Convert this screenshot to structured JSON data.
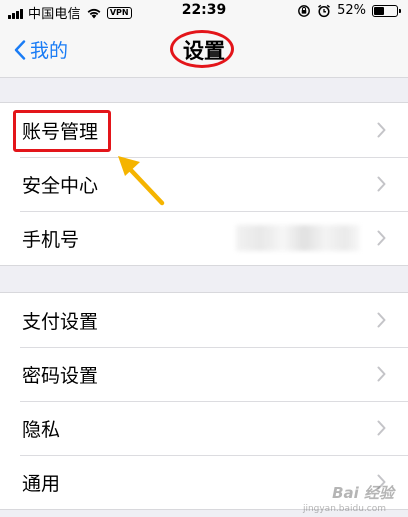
{
  "status_bar": {
    "carrier": "中国电信",
    "vpn": "VPN",
    "time": "22:39",
    "battery_percent": "52%",
    "battery_level": 0.52,
    "icons": [
      "signal-icon",
      "wifi-icon",
      "rotation-lock-icon",
      "alarm-icon",
      "battery-icon"
    ]
  },
  "nav": {
    "back_label": "我的",
    "title": "设置"
  },
  "groups": [
    {
      "items": [
        {
          "label": "账号管理"
        },
        {
          "label": "安全中心"
        },
        {
          "label": "手机号"
        }
      ]
    },
    {
      "items": [
        {
          "label": "支付设置"
        },
        {
          "label": "密码设置"
        },
        {
          "label": "隐私"
        },
        {
          "label": "通用"
        }
      ]
    }
  ],
  "annotations": {
    "highlight_color": "#e3151a",
    "arrow_color": "#f5b400"
  },
  "watermark": {
    "text": "Bai 经验",
    "sub": "jingyan.baidu.com"
  },
  "colors": {
    "accent": "#1a7cf5",
    "background": "#efeff4"
  }
}
